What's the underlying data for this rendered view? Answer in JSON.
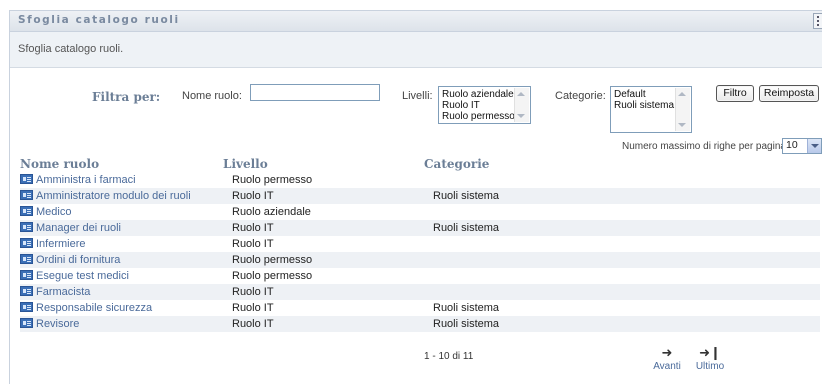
{
  "panel": {
    "title": "Sfoglia catalogo ruoli",
    "subtitle": "Sfoglia catalogo ruoli."
  },
  "filters": {
    "filter_by_label": "Filtra per:",
    "role_name_label": "Nome ruolo:",
    "role_name_value": "",
    "levels_label": "Livelli:",
    "levels_options": [
      "Ruolo aziendale",
      "Ruolo IT",
      "Ruolo permesso"
    ],
    "categories_label": "Categorie:",
    "categories_options": [
      "Default",
      "Ruoli sistema"
    ],
    "filter_button": "Filtro",
    "reset_button": "Reimposta"
  },
  "paging": {
    "max_rows_label": "Numero massimo di righe per pagina",
    "max_rows_value": "10",
    "range_text": "1 - 10 di 11",
    "next_label": "Avanti",
    "last_label": "Ultimo"
  },
  "table": {
    "headers": [
      "Nome ruolo",
      "Livello",
      "Categorie"
    ],
    "rows": [
      {
        "name": "Amministra i farmaci",
        "level": "Ruolo permesso",
        "category": ""
      },
      {
        "name": "Amministratore modulo dei ruoli",
        "level": "Ruolo IT",
        "category": "Ruoli sistema"
      },
      {
        "name": "Medico",
        "level": "Ruolo aziendale",
        "category": ""
      },
      {
        "name": "Manager dei ruoli",
        "level": "Ruolo IT",
        "category": "Ruoli sistema"
      },
      {
        "name": "Infermiere",
        "level": "Ruolo IT",
        "category": ""
      },
      {
        "name": "Ordini di fornitura",
        "level": "Ruolo permesso",
        "category": ""
      },
      {
        "name": "Esegue test medici",
        "level": "Ruolo permesso",
        "category": ""
      },
      {
        "name": "Farmacista",
        "level": "Ruolo IT",
        "category": ""
      },
      {
        "name": "Responsabile sicurezza",
        "level": "Ruolo IT",
        "category": "Ruoli sistema"
      },
      {
        "name": "Revisore",
        "level": "Ruolo IT",
        "category": "Ruoli sistema"
      }
    ]
  }
}
